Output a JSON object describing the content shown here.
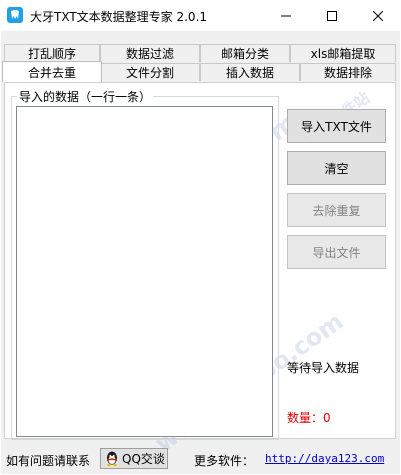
{
  "window": {
    "title": "大牙TXT文本数据整理专家 2.0.1",
    "minimize_icon": "minimize-icon",
    "maximize_icon": "maximize-icon",
    "close_icon": "close-icon"
  },
  "tabs": {
    "row1": [
      "打乱顺序",
      "数据过滤",
      "邮箱分类",
      "xls邮箱提取"
    ],
    "row2": [
      "合并去重",
      "文件分割",
      "插入数据",
      "数据排除"
    ],
    "active": "合并去重"
  },
  "main": {
    "group_label": "导入的数据（一行一条）",
    "textarea_value": "",
    "buttons": {
      "import_txt": "导入TXT文件",
      "clear": "清空",
      "dedupe": "去除重复",
      "export": "导出文件"
    },
    "status": "等待导入数据",
    "count_label": "数量：0"
  },
  "footer": {
    "contact": "如有问题请联系",
    "qq_button": "QQ交谈",
    "more_software": "更多软件：",
    "site_url": "http://daya123.com"
  },
  "watermark": {
    "url": "www.ddooo.com",
    "name": "多多软件站"
  },
  "colors": {
    "accent_icon": "#1fa1e6",
    "count_text": "#e00000",
    "link": "#0000cc"
  }
}
